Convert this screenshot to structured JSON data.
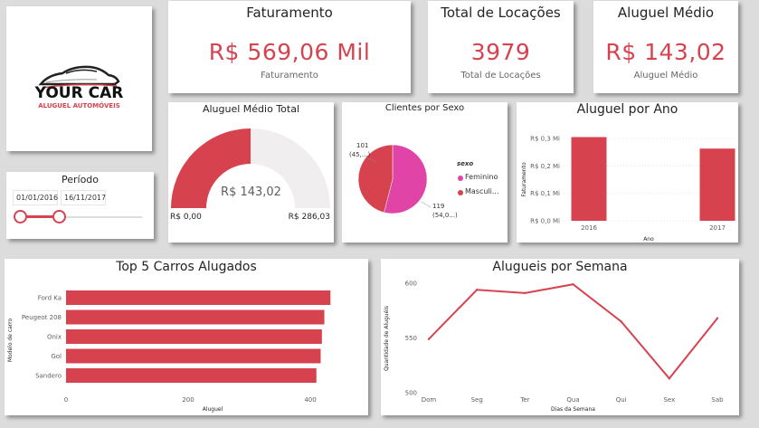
{
  "logo": {
    "brand": "YOUR CAR",
    "tagline": "ALUGUEL AUTOMÓVEIS"
  },
  "colors": {
    "accent": "#d6434f",
    "female": "#e044a7",
    "bg": "#dcdcdc"
  },
  "kpis": {
    "faturamento": {
      "title": "Faturamento",
      "value": "R$ 569,06 Mil",
      "label": "Faturamento"
    },
    "locacoes": {
      "title": "Total de Locações",
      "value": "3979",
      "label": "Total de Locações"
    },
    "aluguel_medio": {
      "title": "Aluguel Médio",
      "value": "R$ 143,02",
      "label": "Aluguel Médio"
    }
  },
  "periodo": {
    "title": "Período",
    "start": "01/01/2016",
    "end": "16/11/2017",
    "range": [
      0.0,
      0.23
    ]
  },
  "chart_data": [
    {
      "type": "gauge",
      "title": "Aluguel Médio Total",
      "value": 143.02,
      "min": 0,
      "max": 286.03,
      "value_label": "R$ 143,02",
      "min_label": "R$ 0,00",
      "max_label": "R$ 286,03"
    },
    {
      "type": "pie",
      "title": "Clientes por Sexo",
      "legend_title": "sexo",
      "legend": [
        "Feminino",
        "Masculi..."
      ],
      "slices": [
        {
          "name": "Feminino",
          "value": 54,
          "label_top": "119",
          "label_bottom": "(54,0...)"
        },
        {
          "name": "Masculino",
          "value": 46,
          "label_top": "101",
          "label_bottom": "(45,...)"
        }
      ]
    },
    {
      "type": "bar",
      "title": "Aluguel por Ano",
      "xlabel": "Ano",
      "ylabel": "Faturamento",
      "categories": [
        "2016",
        "2017"
      ],
      "values": [
        0.305,
        0.263
      ],
      "ylim": [
        0,
        0.3
      ],
      "yticks": [
        "R$ 0,0 Mi",
        "R$ 0,1 Mi",
        "R$ 0,2 Mi",
        "R$ 0,3 Mi"
      ],
      "grid": true
    },
    {
      "type": "bar",
      "orientation": "horizontal",
      "title": "Top 5 Carros Alugados",
      "xlabel": "Aluguel",
      "ylabel": "Modelo de carro",
      "categories": [
        "Ford Ka",
        "Peugeot 208",
        "Onix",
        "Gol",
        "Sandero"
      ],
      "values": [
        433,
        423,
        419,
        417,
        410
      ],
      "xlim": [
        0,
        440
      ],
      "xticks": [
        "0",
        "200",
        "400"
      ]
    },
    {
      "type": "line",
      "title": "Alugueis por Semana",
      "xlabel": "Dias da Semana",
      "ylabel": "Quantidade de Aluguéis",
      "categories": [
        "Dom",
        "Seg",
        "Ter",
        "Qua",
        "Qui",
        "Sex",
        "Sab"
      ],
      "values": [
        549,
        594,
        591,
        599,
        565,
        513,
        568
      ],
      "ylim": [
        500,
        600
      ],
      "yticks": [
        "500",
        "550",
        "600"
      ]
    }
  ]
}
